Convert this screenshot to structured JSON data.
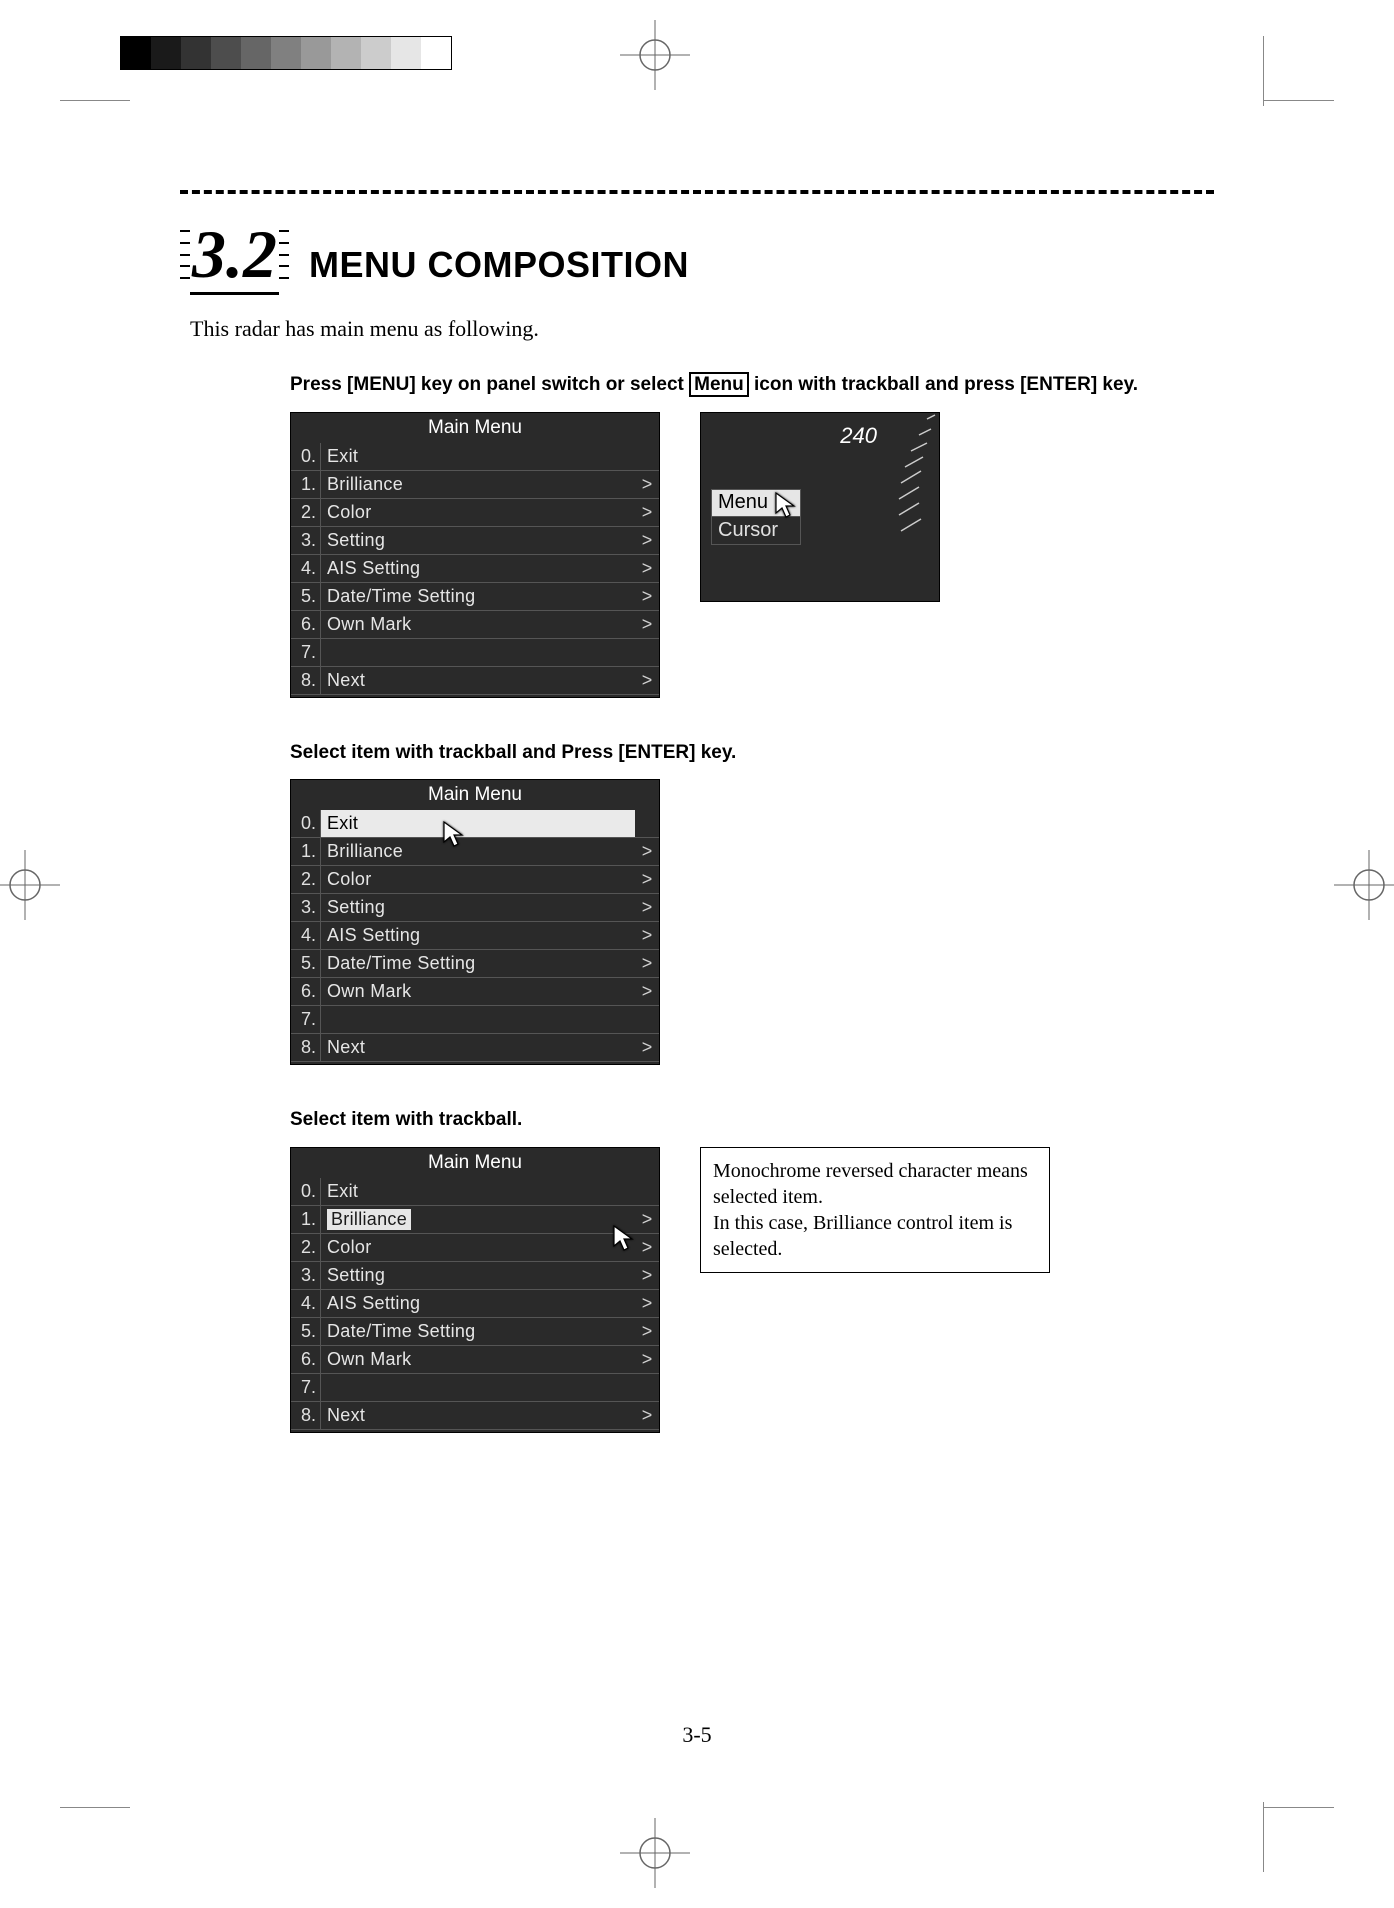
{
  "section": {
    "number": "3.2",
    "title": "MENU COMPOSITION",
    "intro": "This radar has main menu as following."
  },
  "steps": {
    "s1_pre": "Press [MENU] key on panel switch or select ",
    "s1_boxed": "Menu",
    "s1_post": " icon with trackball and press [ENTER] key.",
    "s2": "Select item with trackball and Press [ENTER] key.",
    "s3": "Select item with trackball."
  },
  "main_menu": {
    "title": "Main  Menu",
    "items": [
      {
        "num": "0.",
        "label": "Exit",
        "arrow": false
      },
      {
        "num": "1.",
        "label": "Brilliance",
        "arrow": true
      },
      {
        "num": "2.",
        "label": "Color",
        "arrow": true
      },
      {
        "num": "3.",
        "label": "Setting",
        "arrow": true
      },
      {
        "num": "4.",
        "label": "AIS  Setting",
        "arrow": true
      },
      {
        "num": "5.",
        "label": "Date/Time  Setting",
        "arrow": true
      },
      {
        "num": "6.",
        "label": "Own  Mark",
        "arrow": true
      },
      {
        "num": "7.",
        "label": "",
        "arrow": false
      },
      {
        "num": "8.",
        "label": "Next",
        "arrow": true
      }
    ],
    "arrow_glyph": ">"
  },
  "mini": {
    "scale": "240",
    "menu": "Menu",
    "cursor": "Cursor"
  },
  "note": {
    "line1": "Monochrome reversed character means selected item.",
    "line2": "In this case, Brilliance control item is selected."
  },
  "page_number": "3-5"
}
